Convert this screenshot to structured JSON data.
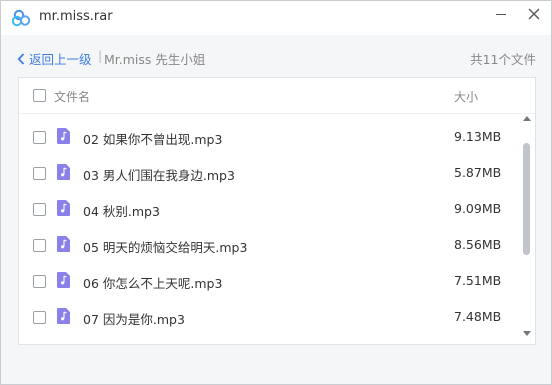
{
  "window": {
    "title": "mr.miss.rar"
  },
  "pathbar": {
    "back_label": "返回上一级",
    "separator": "|",
    "crumb": "Mr.miss 先生小姐",
    "count": "共11个文件"
  },
  "table": {
    "col_name": "文件名",
    "col_size": "大小",
    "rows": [
      {
        "name": "02 如果你不曾出现.mp3",
        "size": "9.13MB"
      },
      {
        "name": "03 男人们围在我身边.mp3",
        "size": "5.87MB"
      },
      {
        "name": "04 秋别.mp3",
        "size": "9.09MB"
      },
      {
        "name": "05 明天的烦恼交给明天.mp3",
        "size": "8.56MB"
      },
      {
        "name": "06 你怎么不上天呢.mp3",
        "size": "7.51MB"
      },
      {
        "name": "07 因为是你.mp3",
        "size": "7.48MB"
      }
    ]
  },
  "colors": {
    "accent": "#3d7fe0",
    "file_icon": "#8b80e8"
  },
  "icons": {
    "logo": "baidu-netdisk-logo-icon",
    "file": "audio-file-icon",
    "back": "chevron-left-icon"
  }
}
